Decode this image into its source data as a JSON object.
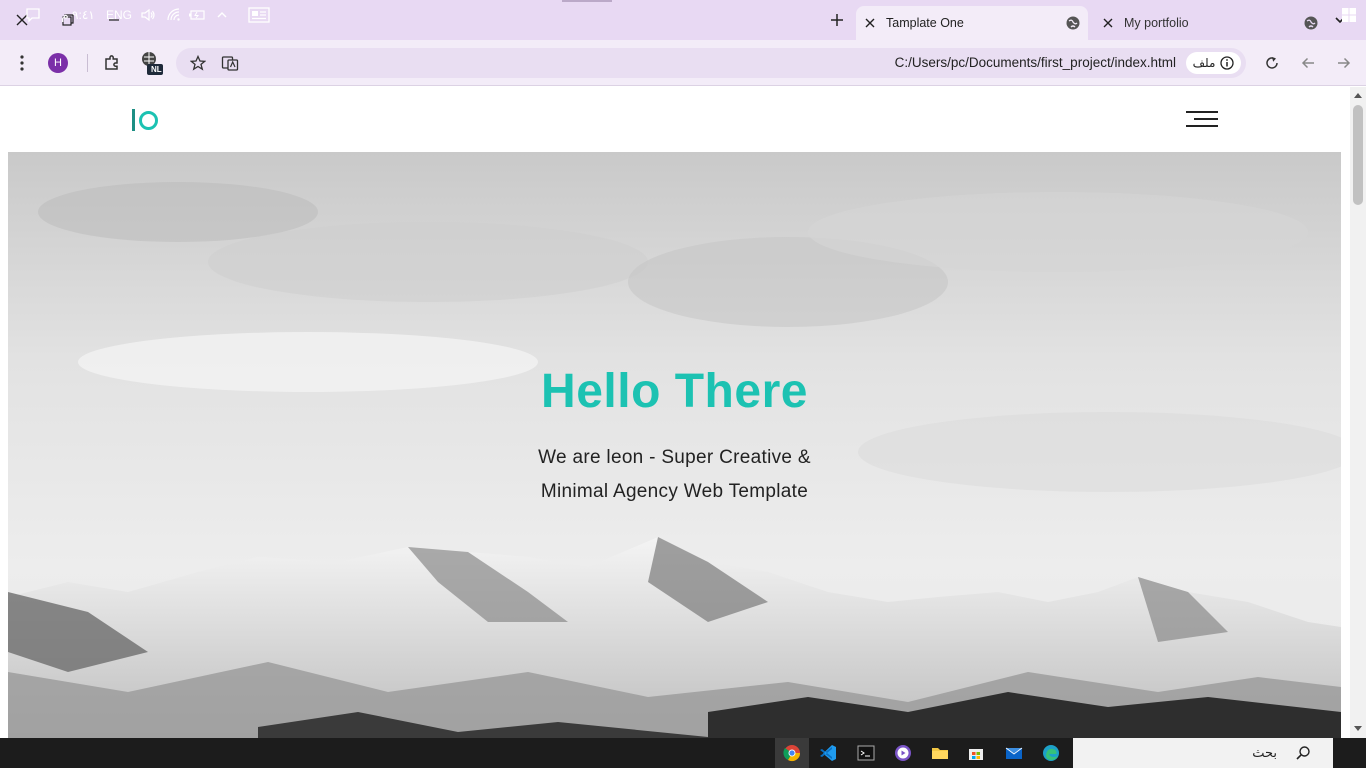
{
  "browser": {
    "tabs": [
      {
        "title": "Tamplate One",
        "active": true
      },
      {
        "title": "My portfolio",
        "active": false
      }
    ],
    "avatar_letter": "H",
    "extension_badge": "NL",
    "address": {
      "url": "C:/Users/pc/Documents/first_project/index.html",
      "chip_label": "ملف"
    },
    "icons": [
      "close-window-icon",
      "restore-window-icon",
      "minimize-window-icon",
      "new-tab-icon",
      "globe-icon",
      "tab-list-icon",
      "menu-dots-icon",
      "extensions-icon",
      "bookmark-star-icon",
      "translate-icon",
      "info-icon",
      "reload-icon",
      "back-arrow-icon",
      "forward-arrow-icon"
    ]
  },
  "site": {
    "logo_text": "IO",
    "hero_title": "Hello There",
    "hero_subtitle_line1": "We are leon - Super Creative &",
    "hero_subtitle_line2": "Minimal Agency Web Template",
    "accent_color": "#1cc2b2"
  },
  "taskbar": {
    "time": "٩:٤١ م",
    "language": "ENG",
    "search_placeholder": "بحث",
    "apps": [
      "chrome-icon",
      "vscode-icon",
      "terminal-icon",
      "media-player-icon",
      "file-explorer-icon",
      "store-icon",
      "mail-icon",
      "edge-icon"
    ]
  }
}
